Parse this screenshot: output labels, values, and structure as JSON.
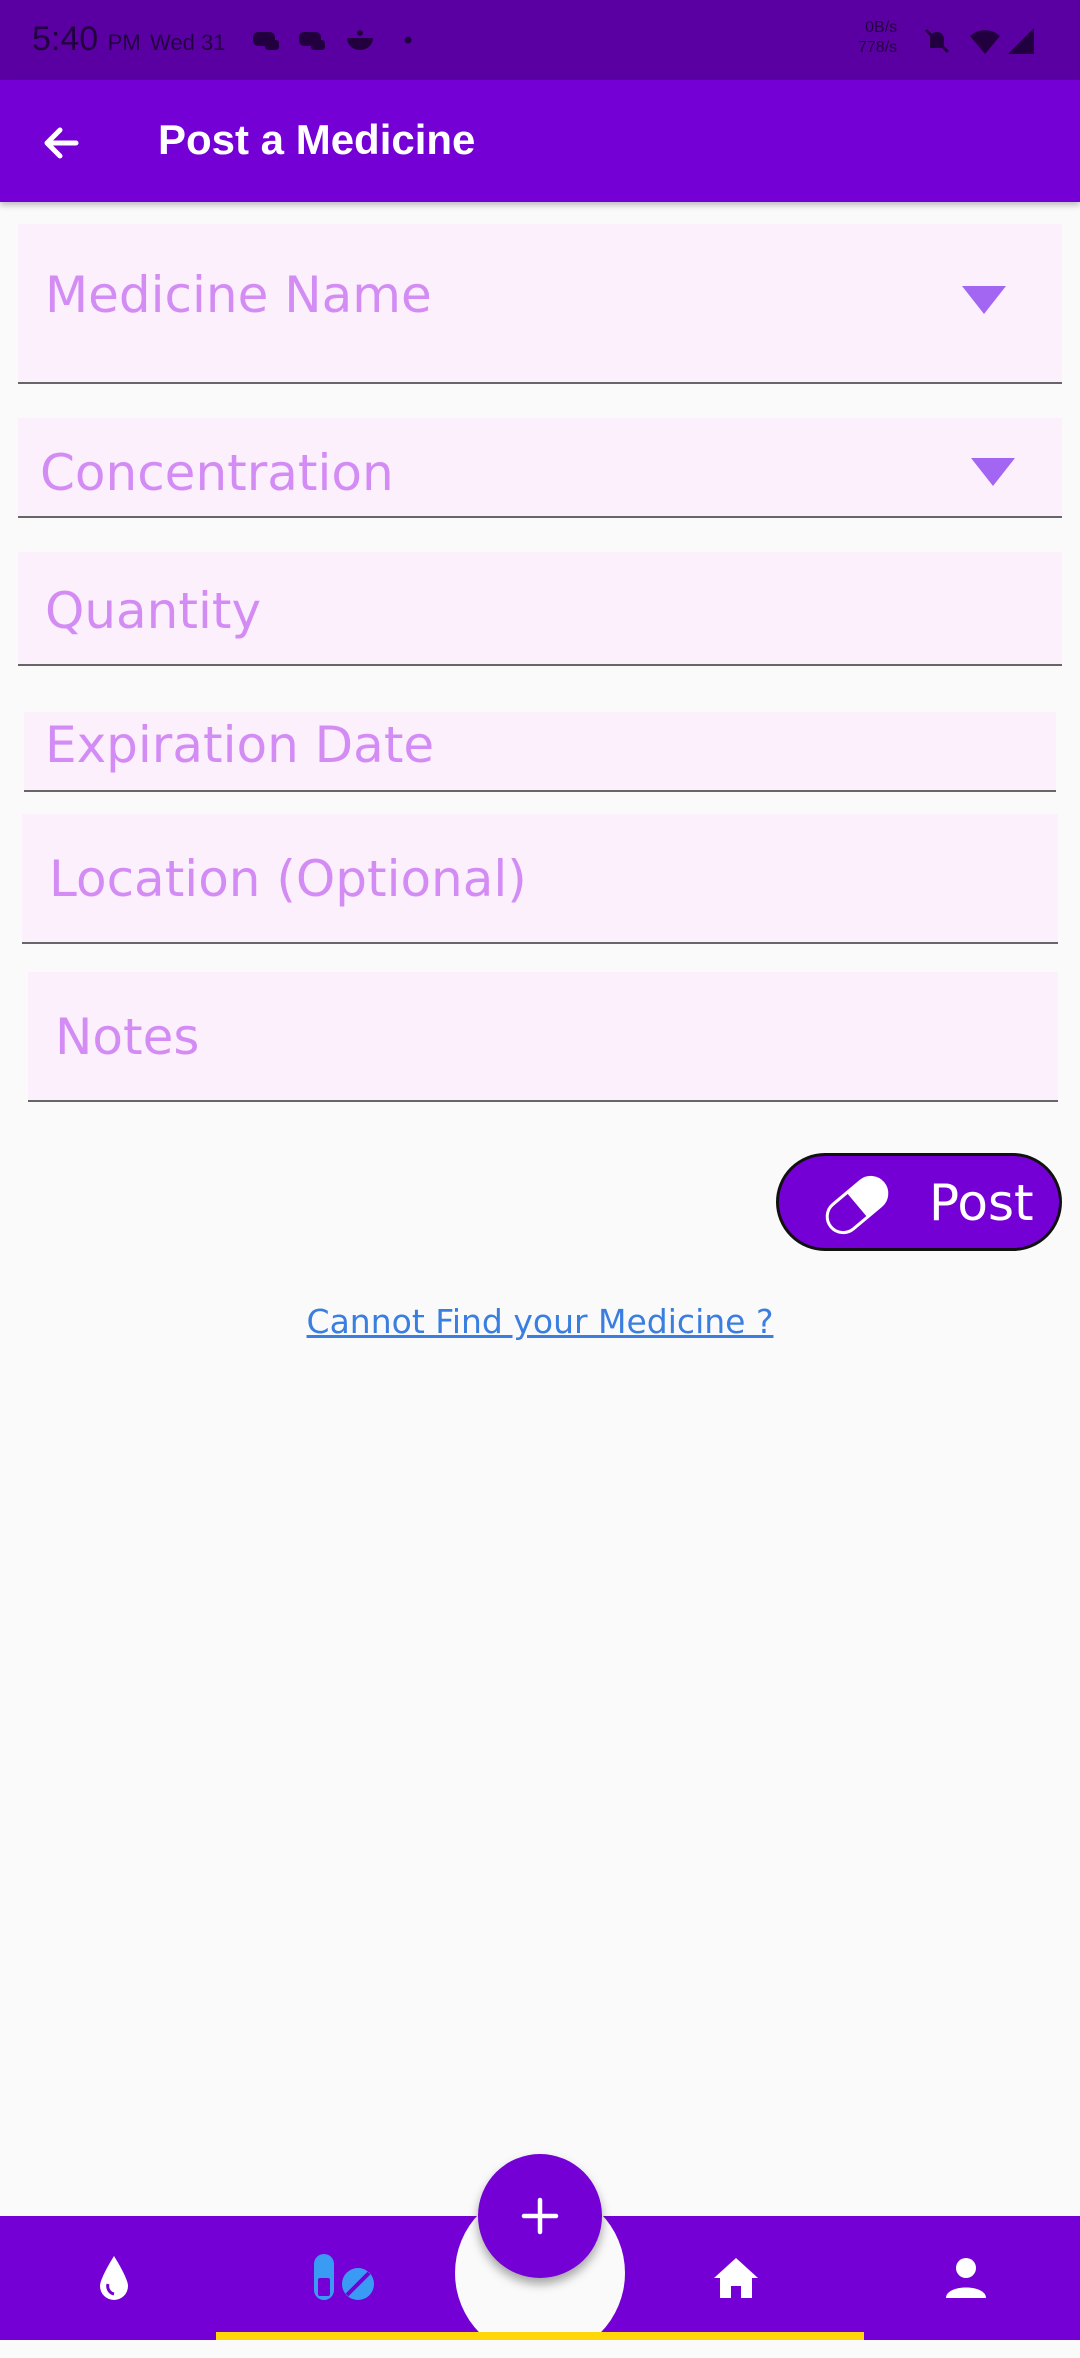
{
  "status_bar": {
    "time": "5:40",
    "ampm": "PM",
    "date": "Wed 31",
    "speed_up": "0B/s",
    "speed_down": "778/s"
  },
  "app_bar": {
    "title": "Post a Medicine",
    "back_icon": "arrow-left-icon"
  },
  "form": {
    "medicine_name": "Medicine Name",
    "concentration": "Concentration",
    "quantity": "Quantity",
    "expiration_date": "Expiration Date",
    "location": "Location (Optional)",
    "notes": "Notes"
  },
  "post_button": {
    "label": "Post",
    "icon": "pill-icon"
  },
  "cannot_find_link": "Cannot Find your Medicine ?",
  "bottom_nav": {
    "items": [
      "drop-icon",
      "pills-icon",
      "home-icon",
      "person-icon"
    ],
    "fab_icon": "plus-icon",
    "active_index": 1
  },
  "colors": {
    "primary": "#7400d6",
    "status_bar": "#5a00a3",
    "field_bg": "#fdf0fd",
    "field_label": "#d48cf5",
    "link": "#3a7fe0",
    "indicator": "#ffd60a"
  }
}
